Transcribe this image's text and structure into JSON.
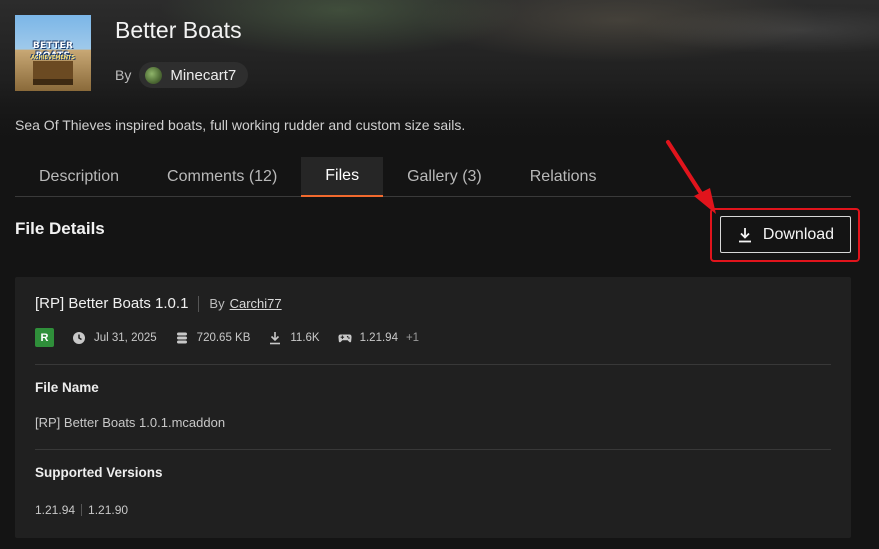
{
  "project": {
    "title": "Better Boats",
    "by_label": "By",
    "author": "Minecart7",
    "description": "Sea Of Thieves inspired boats, full working rudder and custom size sails.",
    "logo_text_main": "BETTER BOATS",
    "logo_text_sub": "ACHIEVEMENTS"
  },
  "tabs": [
    {
      "label": "Description",
      "active": false
    },
    {
      "label": "Comments (12)",
      "active": false
    },
    {
      "label": "Files",
      "active": true
    },
    {
      "label": "Gallery (3)",
      "active": false
    },
    {
      "label": "Relations",
      "active": false
    }
  ],
  "section": {
    "title": "File Details",
    "download_label": "Download"
  },
  "file": {
    "title": "[RP] Better Boats 1.0.1",
    "by_label": "By",
    "uploader": "Carchi77",
    "release_badge": "R",
    "date": "Jul 31, 2025",
    "size": "720.65 KB",
    "downloads": "11.6K",
    "game_version": "1.21.94",
    "game_version_extra": "+1",
    "file_name_label": "File Name",
    "file_name": "[RP] Better Boats 1.0.1.mcaddon",
    "supported_versions_label": "Supported Versions",
    "supported_versions": [
      "1.21.94",
      "1.21.90"
    ]
  },
  "icons": {
    "download": "download-icon",
    "date": "clock-icon",
    "size": "database-icon",
    "downloads": "download-icon",
    "game_version": "gamepad-icon"
  },
  "colors": {
    "accent": "#f26a2e",
    "release_badge": "#2f8f3a",
    "annotation": "#e1141c"
  }
}
